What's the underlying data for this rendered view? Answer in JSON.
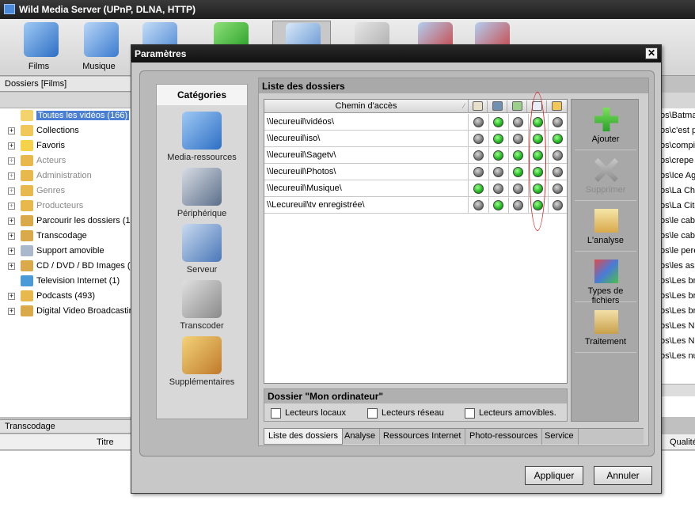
{
  "app": {
    "title": "Wild Media Server (UPnP, DLNA, HTTP)"
  },
  "toolbar": {
    "films_label": "Films",
    "music_label": "Musique"
  },
  "left": {
    "header": "Dossiers [Films]",
    "tree": [
      {
        "label": "Toutes les vidéos (166)",
        "selected": true
      },
      {
        "label": "Collections"
      },
      {
        "label": "Favoris"
      },
      {
        "label": "Acteurs",
        "gray": true
      },
      {
        "label": "Administration",
        "gray": true
      },
      {
        "label": "Genres",
        "gray": true
      },
      {
        "label": "Producteurs",
        "gray": true
      },
      {
        "label": "Parcourir les dossiers (16"
      },
      {
        "label": "Transcodage"
      },
      {
        "label": "Support amovible"
      },
      {
        "label": "CD / DVD / BD Images (I"
      },
      {
        "label": "Television Internet (1)"
      },
      {
        "label": "Podcasts (493)"
      },
      {
        "label": "Digital Video Broadcastin"
      }
    ],
    "transcode_bar": "Transcodage",
    "transcode_col": "Titre"
  },
  "right": {
    "rows": [
      "os\\Batma",
      "os\\c'est p",
      "os\\compil",
      "os\\crepe",
      "os\\Ice Ag",
      "os\\La Cha",
      "os\\La Cite",
      "os\\le caba",
      "os\\le caba",
      "os\\le pere",
      "os\\les ass",
      "os\\Les br",
      "os\\Les br",
      "os\\Les br",
      "os\\Les Nu",
      "os\\Les Nu",
      "os\\Les nu"
    ],
    "quality_col": "Qualité"
  },
  "dialog": {
    "title": "Paramètres",
    "close_glyph": "✕",
    "categories_title": "Catégories",
    "categories": [
      "Media-ressources",
      "Périphérique",
      "Serveur",
      "Transcoder",
      "Supplémentaires"
    ],
    "list_title": "Liste des dossiers",
    "path_header": "Chemin d'accès",
    "sort_glyph": "⁄",
    "rows": [
      {
        "path": "\\\\lecureuil\\vidéos\\",
        "states": [
          0,
          1,
          0,
          1,
          0
        ]
      },
      {
        "path": "\\\\lecureuil\\iso\\",
        "states": [
          0,
          1,
          0,
          1,
          1
        ]
      },
      {
        "path": "\\\\lecureuil\\Sagetv\\",
        "states": [
          0,
          1,
          1,
          1,
          0
        ]
      },
      {
        "path": "\\\\lecureuil\\Photos\\",
        "states": [
          0,
          0,
          1,
          1,
          0
        ]
      },
      {
        "path": "\\\\lecureuil\\Musique\\",
        "states": [
          1,
          0,
          0,
          1,
          0
        ]
      },
      {
        "path": "\\\\Lecureuil\\tv enregistrée\\",
        "states": [
          0,
          1,
          0,
          1,
          0
        ]
      }
    ],
    "side_buttons": [
      {
        "label": "Ajouter",
        "disabled": false
      },
      {
        "label": "Supprimer",
        "disabled": true
      },
      {
        "label": "L'analyse",
        "disabled": false
      },
      {
        "label": "Types de fichiers",
        "disabled": false
      },
      {
        "label": "Traitement",
        "disabled": false
      }
    ],
    "my_computer_title": "Dossier \"Mon ordinateur\"",
    "checkboxes": [
      "Lecteurs locaux",
      "Lecteurs réseau",
      "Lecteurs amovibles."
    ],
    "tabs": [
      "Liste des dossiers",
      "Analyse",
      "Ressources Internet",
      "Photo-ressources",
      "Service"
    ],
    "apply_label": "Appliquer",
    "cancel_label": "Annuler"
  },
  "colors": {
    "on": "#1fb41f",
    "off": "#7a7a7a",
    "highlight": "#d22222"
  }
}
